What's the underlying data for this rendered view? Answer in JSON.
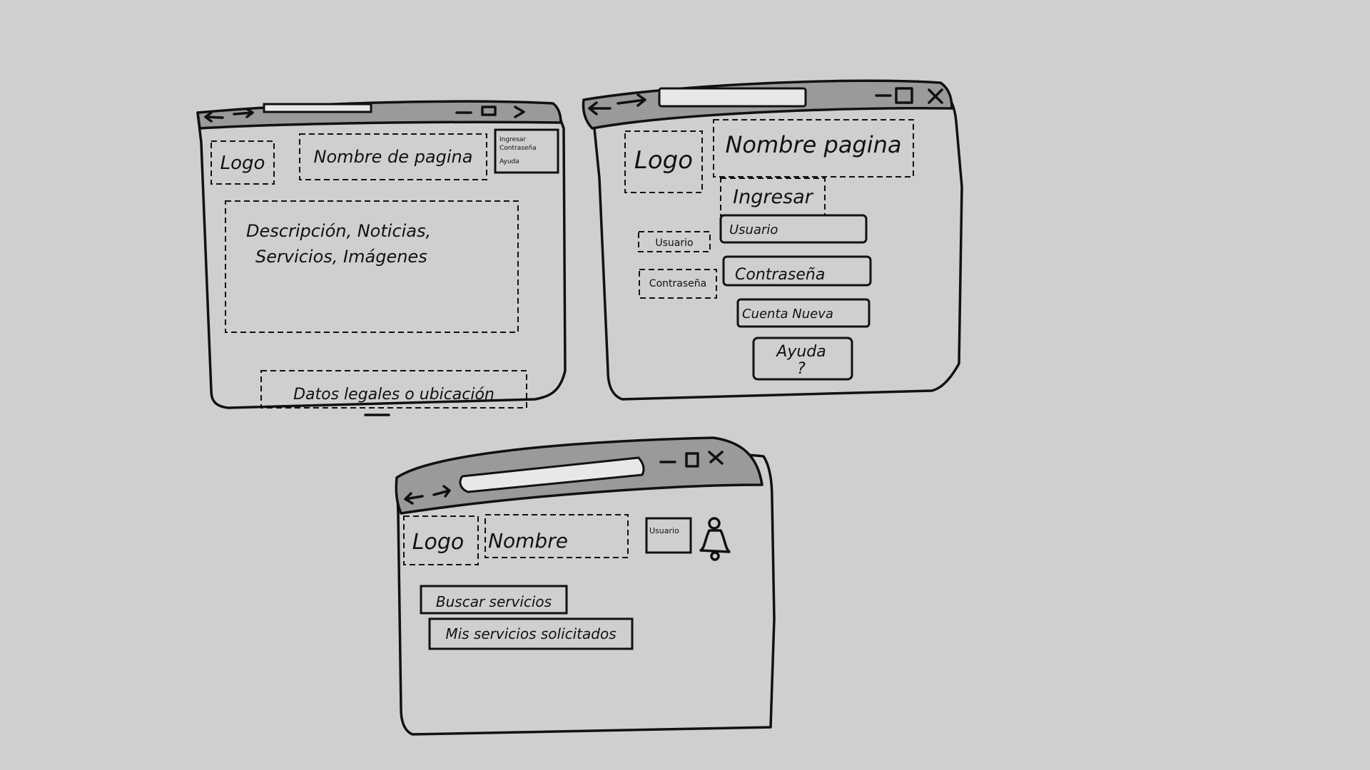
{
  "window1": {
    "logo": "Logo",
    "page_name": "Nombre de pagina",
    "menu_line1": "Ingresar",
    "menu_line2": "Contraseña",
    "menu_line3": "Ayuda",
    "content_line1": "Descripción, Noticias,",
    "content_line2": "Servicios, Imágenes",
    "footer": "Datos legales o ubicación"
  },
  "window2": {
    "logo": "Logo",
    "page_name": "Nombre pagina",
    "login_title": "Ingresar",
    "user_label": "Usuario",
    "user_value": "Usuario",
    "password_label": "Contraseña",
    "password_value": "Contraseña",
    "new_account": "Cuenta Nueva",
    "help_line1": "Ayuda",
    "help_line2": "?"
  },
  "window3": {
    "logo": "Logo",
    "page_name": "Nombre",
    "user_box": "Usuario",
    "search_services": "Buscar servicios",
    "my_services": "Mis servicios solicitados"
  },
  "icons": {
    "back": "arrow-left",
    "forward": "arrow-right",
    "minimize": "minus",
    "maximize": "square",
    "close": "x",
    "user": "person"
  },
  "colors": {
    "background": "#cfcfcf",
    "titlebar": "#9a9a9a",
    "ink": "#111111"
  }
}
